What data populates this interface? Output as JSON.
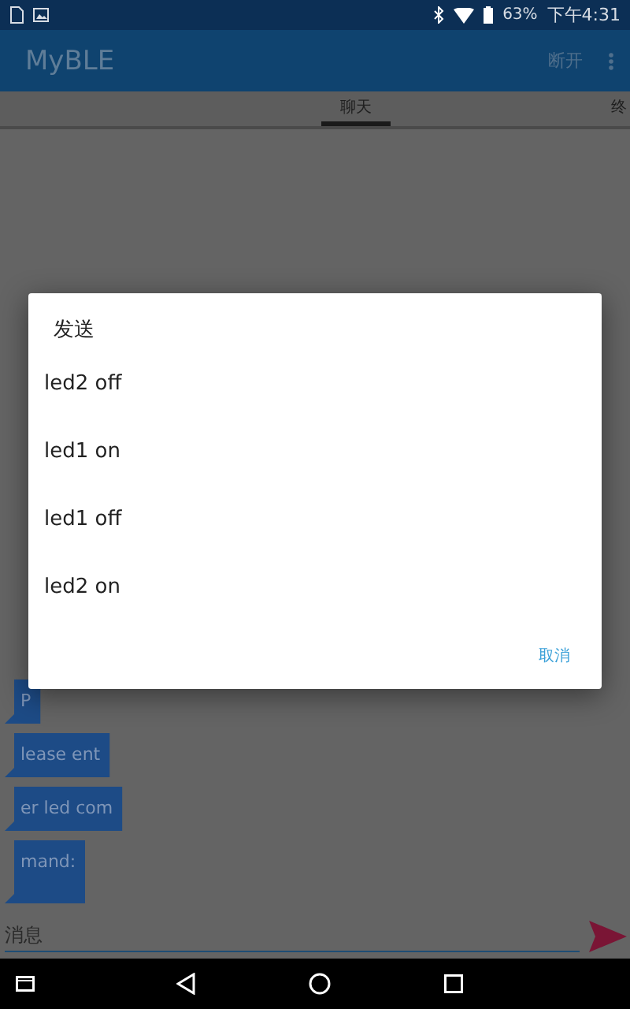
{
  "status_bar": {
    "battery": "63%",
    "time": "下午4:31"
  },
  "app_bar": {
    "title": "MyBLE",
    "action": "断开"
  },
  "tabs": [
    {
      "label": "聊天",
      "selected": true
    },
    {
      "label": "终",
      "selected": false
    }
  ],
  "messages": [
    "P",
    "lease ent",
    "er led com",
    "mand:"
  ],
  "input": {
    "placeholder": "消息"
  },
  "dialog": {
    "title": "发送",
    "items": [
      "led2 off",
      "led1 on",
      "led1 off",
      "led2 on"
    ],
    "cancel": "取消"
  }
}
